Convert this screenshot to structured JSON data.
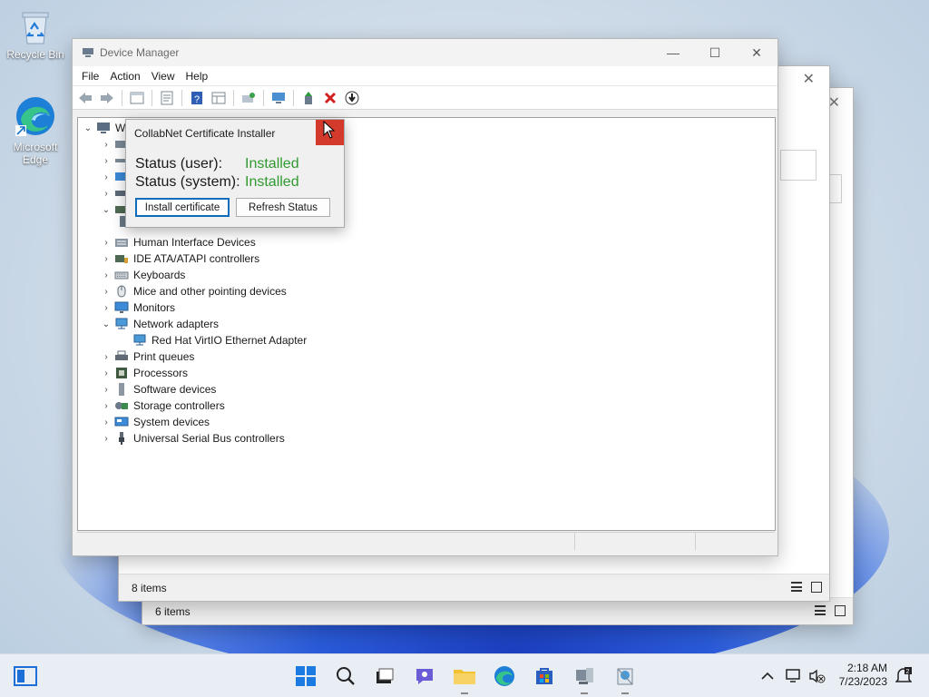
{
  "desktop": {
    "icons": [
      {
        "label": "Recycle Bin"
      },
      {
        "label": "Microsoft Edge"
      }
    ]
  },
  "back_windows": {
    "front_status": "8 items",
    "rear_status": "6 items"
  },
  "device_manager": {
    "title": "Device Manager",
    "menu": [
      "File",
      "Action",
      "View",
      "Help"
    ],
    "root_initial": "W",
    "tree": [
      {
        "label": "Human Interface Devices",
        "expanded": false
      },
      {
        "label": "IDE ATA/ATAPI controllers",
        "expanded": false
      },
      {
        "label": "Keyboards",
        "expanded": false
      },
      {
        "label": "Mice and other pointing devices",
        "expanded": false
      },
      {
        "label": "Monitors",
        "expanded": false
      },
      {
        "label": "Network adapters",
        "expanded": true
      },
      {
        "label": "Red Hat VirtIO Ethernet Adapter",
        "child": true
      },
      {
        "label": "Print queues",
        "expanded": false
      },
      {
        "label": "Processors",
        "expanded": false
      },
      {
        "label": "Software devices",
        "expanded": false
      },
      {
        "label": "Storage controllers",
        "expanded": false
      },
      {
        "label": "System devices",
        "expanded": false
      },
      {
        "label": "Universal Serial Bus controllers",
        "expanded": false
      }
    ]
  },
  "dialog": {
    "title": "CollabNet Certificate Installer",
    "status_user_label": "Status (user):",
    "status_user_value": "Installed",
    "status_system_label": "Status (system):",
    "status_system_value": "Installed",
    "install_button": "Install certificate",
    "refresh_button": "Refresh Status",
    "status_color": "#2f9a2f"
  },
  "taskbar": {
    "time": "2:18 AM",
    "date": "7/23/2023"
  }
}
